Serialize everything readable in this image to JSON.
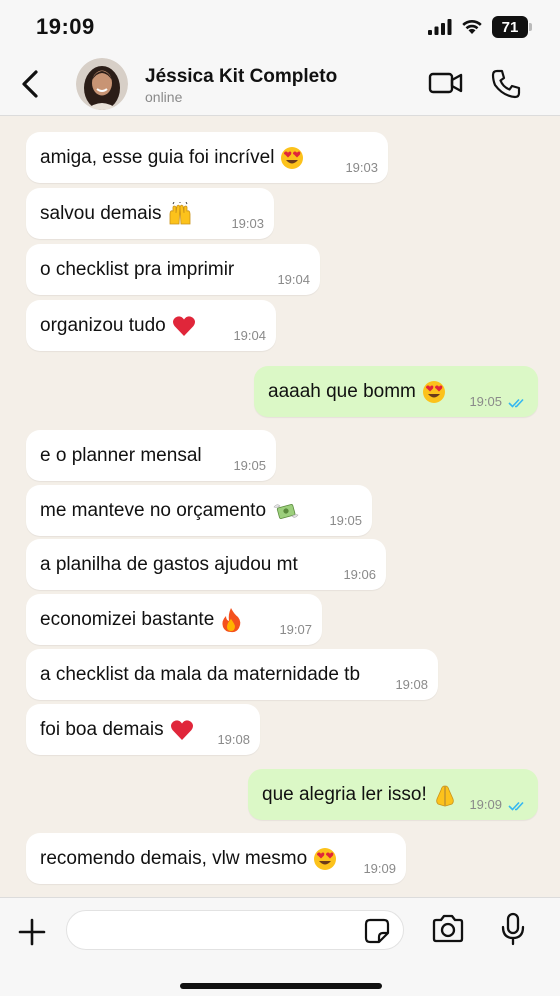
{
  "status_bar": {
    "time": "19:09",
    "battery": "71"
  },
  "header": {
    "contact_name": "Jéssica Kit Completo",
    "contact_status": "online"
  },
  "messages": [
    {
      "text": "amiga, esse guia foi incrível",
      "emoji": "heart-eyes",
      "time": "19:03",
      "direction": "in"
    },
    {
      "text": "salvou demais",
      "emoji": "raised-hands",
      "time": "19:03",
      "direction": "in"
    },
    {
      "text": "o checklist pra imprimir",
      "emoji": "",
      "time": "19:04",
      "direction": "in"
    },
    {
      "text": "organizou tudo",
      "emoji": "red-heart",
      "time": "19:04",
      "direction": "in"
    },
    {
      "text": "aaaah que bomm",
      "emoji": "heart-eyes",
      "time": "19:05",
      "direction": "out",
      "read": true
    },
    {
      "text": "e o planner mensal",
      "emoji": "",
      "time": "19:05",
      "direction": "in"
    },
    {
      "text": "me manteve no orçamento",
      "emoji": "money-wings",
      "time": "19:05",
      "direction": "in"
    },
    {
      "text": "a planilha de gastos ajudou mt",
      "emoji": "",
      "time": "19:06",
      "direction": "in"
    },
    {
      "text": "economizei bastante",
      "emoji": "fire",
      "time": "19:07",
      "direction": "in"
    },
    {
      "text": "a checklist da mala da maternidade tb",
      "emoji": "",
      "time": "19:08",
      "direction": "in"
    },
    {
      "text": "foi boa demais",
      "emoji": "red-heart",
      "time": "19:08",
      "direction": "in"
    },
    {
      "text": "que alegria ler isso!",
      "emoji": "folded-hands",
      "time": "19:09",
      "direction": "out",
      "read": true
    },
    {
      "text": "recomendo demais, vlw mesmo",
      "emoji": "heart-eyes",
      "time": "19:09",
      "direction": "in"
    }
  ],
  "input": {
    "placeholder": "",
    "value": ""
  },
  "colors": {
    "chat_background": "#f4efe8",
    "incoming_bubble": "#ffffff",
    "outgoing_bubble": "#dbf8c6",
    "read_ticks": "#34b7f1",
    "header_background": "#f7f7f7"
  },
  "icons": [
    "back-chevron-icon",
    "video-call-icon",
    "phone-icon",
    "plus-icon",
    "sticker-icon",
    "camera-icon",
    "microphone-icon"
  ]
}
